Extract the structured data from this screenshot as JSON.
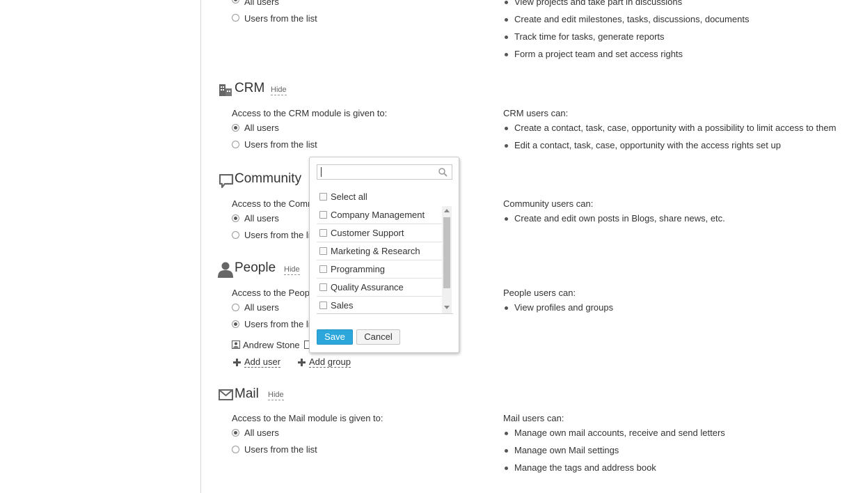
{
  "projects": {
    "radio_all": "All users",
    "radio_list": "Users from the list",
    "bullets": [
      "View projects and take part in discussions",
      "Create and edit milestones, tasks, discussions, documents",
      "Track time for tasks, generate reports",
      "Form a project team and set access rights"
    ]
  },
  "crm": {
    "title": "CRM",
    "hide": "Hide",
    "access": "Access to the CRM module is given to:",
    "radio_all": "All users",
    "radio_list": "Users from the list",
    "can_title": "CRM users can:",
    "bullets": [
      "Create a contact, task, case, opportunity with a possibility to limit access to them",
      "Edit a contact, task, case, opportunity with the access rights set up"
    ]
  },
  "community": {
    "title": "Community",
    "access": "Access to the Comm",
    "radio_all": "All users",
    "radio_list": "Users from the li",
    "can_title": "Community users can:",
    "bullets": [
      "Create and edit own posts in Blogs, share news, etc."
    ]
  },
  "people": {
    "title": "People",
    "hide": "Hide",
    "access": "Access to the People",
    "radio_all": "All users",
    "radio_list": "Users from the li",
    "user": "Andrew Stone",
    "add_user": "Add user",
    "add_group": "Add group",
    "can_title": "People users can:",
    "bullets": [
      "View profiles and groups"
    ]
  },
  "mail": {
    "title": "Mail",
    "hide": "Hide",
    "access": "Access to the Mail module is given to:",
    "radio_all": "All users",
    "radio_list": "Users from the list",
    "can_title": "Mail users can:",
    "bullets": [
      "Manage own mail accounts, receive and send letters",
      "Manage own Mail settings",
      "Manage the tags and address book"
    ]
  },
  "popup": {
    "search_value": "",
    "select_all": "Select all",
    "groups": [
      "Company Management",
      "Customer Support",
      "Marketing & Research",
      "Programming",
      "Quality Assurance",
      "Sales"
    ],
    "save": "Save",
    "cancel": "Cancel"
  },
  "colors": {
    "accent": "#2da7db",
    "text": "#333333"
  }
}
